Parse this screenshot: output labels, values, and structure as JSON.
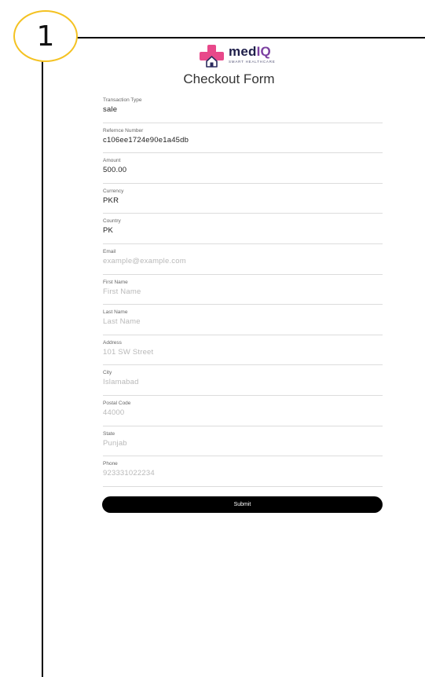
{
  "step": {
    "number": "1"
  },
  "brand": {
    "name_primary": "med",
    "name_accent": "IQ",
    "tagline": "SMART HEALTHCARE"
  },
  "form": {
    "title": "Checkout Form",
    "fields": [
      {
        "label": "Transaction Type",
        "value": "sale",
        "placeholder": ""
      },
      {
        "label": "Refernce Number",
        "value": "c106ee1724e90e1a45db",
        "placeholder": ""
      },
      {
        "label": "Amount",
        "value": "500.00",
        "placeholder": ""
      },
      {
        "label": "Currency",
        "value": "PKR",
        "placeholder": ""
      },
      {
        "label": "Country",
        "value": "PK",
        "placeholder": ""
      },
      {
        "label": "Email",
        "value": "",
        "placeholder": "example@example.com"
      },
      {
        "label": "First Name",
        "value": "",
        "placeholder": "First Name"
      },
      {
        "label": "Last Name",
        "value": "",
        "placeholder": "Last Name"
      },
      {
        "label": "Address",
        "value": "",
        "placeholder": "101 SW Street"
      },
      {
        "label": "City",
        "value": "",
        "placeholder": "Islamabad"
      },
      {
        "label": "Postal Code",
        "value": "",
        "placeholder": "44000"
      },
      {
        "label": "State",
        "value": "",
        "placeholder": "Punjab"
      },
      {
        "label": "Phone",
        "value": "",
        "placeholder": "923331022234"
      }
    ],
    "submit_label": "Submit"
  },
  "colors": {
    "badge_border": "#f4c222",
    "brand_pink": "#e8488a",
    "brand_purple": "#7b3fa0",
    "brand_navy": "#1f1f4a",
    "button_bg": "#000000"
  }
}
